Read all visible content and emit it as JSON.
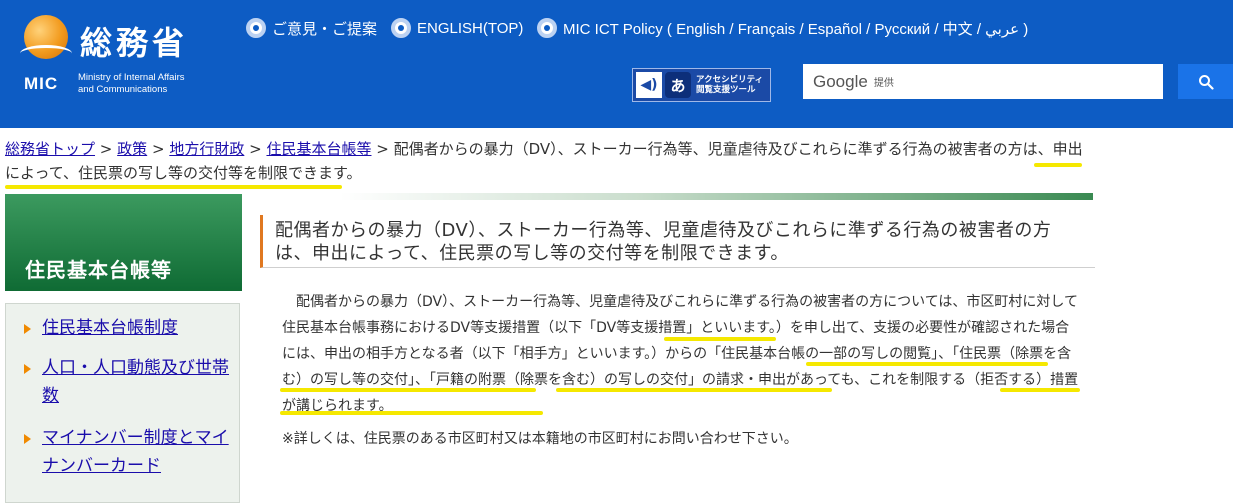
{
  "header": {
    "logo_kanji": "総務省",
    "logo_abbr": "MIC",
    "logo_english_line1": "Ministry of Internal Affairs",
    "logo_english_line2": "and Communications",
    "links": [
      {
        "label": "ご意見・ご提案"
      },
      {
        "label": "ENGLISH(TOP)"
      },
      {
        "label": "MIC ICT Policy ( English / Français / Español / Русский / 中文 / عربي )"
      }
    ],
    "accessibility_label_line1": "アクセシビリティ",
    "accessibility_label_line2": "閲覧支援ツール",
    "search": {
      "brand": "Google",
      "suffix": "提供"
    }
  },
  "breadcrumb": {
    "items": [
      "総務省トップ",
      "政策",
      "地方行財政",
      "住民基本台帳等"
    ],
    "separator": ">",
    "current": "配偶者からの暴力（DV）、ストーカー行為等、児童虐待及びこれらに準ずる行為の被害者の方は、申出によって、住民票の写し等の交付等を制限できます。"
  },
  "sidebar": {
    "heading": "住民基本台帳等",
    "items": [
      {
        "label": "住民基本台帳制度"
      },
      {
        "label": "人口・人口動態及び世帯数"
      },
      {
        "label": "マイナンバー制度とマイナンバーカード"
      }
    ]
  },
  "main": {
    "title": "配偶者からの暴力（DV）、ストーカー行為等、児童虐待及びこれらに準ずる行為の被害者の方は、申出によって、住民票の写し等の交付等を制限できます。",
    "body": "　配偶者からの暴力（DV）、ストーカー行為等、児童虐待及びこれらに準ずる行為の被害者の方については、市区町村に対して住民基本台帳事務におけるDV等支援措置（以下「DV等支援措置」といいます。）を申し出て、支援の必要性が確認された場合には、申出の相手方となる者（以下「相手方」といいます。）からの「住民基本台帳の一部の写しの閲覧」、「住民票（除票を含む）の写し等の交付」、「戸籍の附票（除票を含む）の写しの交付」の請求・申出があっても、これを制限する（拒否する）措置が講じられます。",
    "note": "※詳しくは、住民票のある市区町村又は本籍地の市区町村にお問い合わせ下さい。"
  },
  "colors": {
    "header_bg": "#0d5cc4",
    "sidebar_heading_bg": "#1e7a42",
    "highlight_marker": "#f5e800",
    "title_accent": "#e07820"
  }
}
